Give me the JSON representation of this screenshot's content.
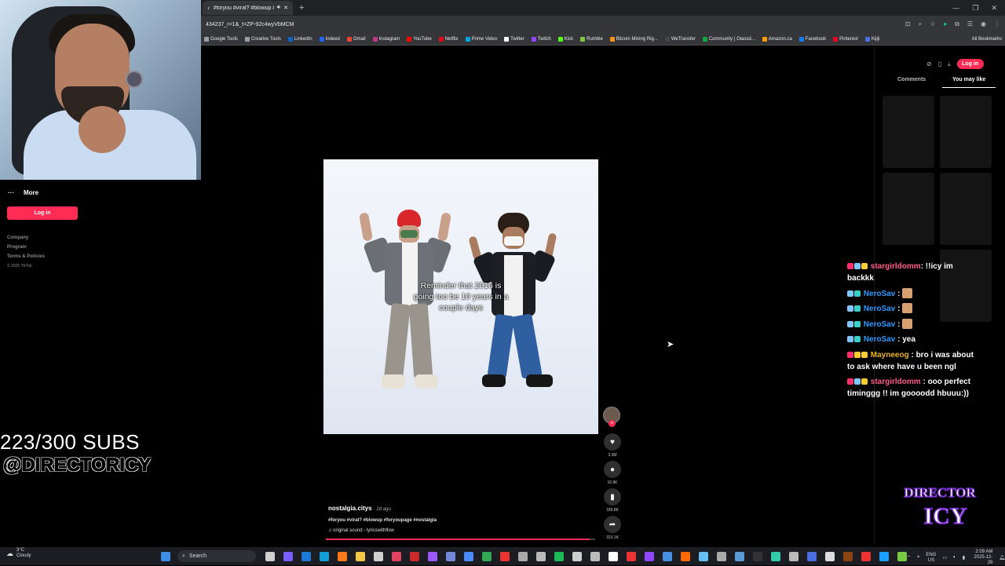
{
  "browser": {
    "tab_title": "#foryou #viral? #blowup #...",
    "url": "434237_r=1&_t=ZP-92c4wyVbMCM",
    "bookmarks": [
      "Google Tools",
      "Creative Tools",
      "LinkedIn",
      "Indeed",
      "Gmail",
      "Instagram",
      "YouTube",
      "Netflix",
      "Prime Video",
      "Twitter",
      "Twitch",
      "Kick",
      "Rumble",
      "Bitcoin Mining Rig...",
      "WeTransfer",
      "Community | Glassd...",
      "Amazon.ca",
      "Facebook",
      "Pinterest",
      "Kijiji"
    ],
    "all_bookmarks": "All Bookmarks",
    "bookmark_colors": [
      "#9aa0a6",
      "#9aa0a6",
      "#0a66c2",
      "#2164f3",
      "#ea4335",
      "#c13584",
      "#ff0000",
      "#e50914",
      "#00a8e1",
      "#ffffff",
      "#9146ff",
      "#53fc18",
      "#85c742",
      "#f7931a",
      "#444",
      "#0caa41",
      "#ff9900",
      "#1877f2",
      "#e60023",
      "#4a6ee0"
    ]
  },
  "sidebar": {
    "more_label": "More",
    "login_label": "Log in",
    "footer": [
      "Company",
      "Program",
      "Terms & Policies"
    ],
    "copyright": "© 2025 TikTok"
  },
  "video": {
    "caption_lines": [
      "Reminder that 2016 is",
      "going too be 10 years in a",
      "couple days"
    ],
    "author": "nostalgia.citys",
    "posted": "· 2d ago",
    "hashtags": "#foryou #viral? #blowup #foryoupage #nostalgia",
    "sound": "original sound - lyricswithflow",
    "likes": "3.3M",
    "comments": "16.9K",
    "saves": "185.8K",
    "shares": "323.1K",
    "progress": 0.98
  },
  "right_panel": {
    "login_label": "Log in",
    "tab_comments": "Comments",
    "tab_you_may_like": "You may like"
  },
  "chat": [
    {
      "user": "stargirldomm",
      "color": "#ff5a8a",
      "text": ": !!icy im backkk",
      "badges": [
        "#ff2d6b",
        "#7ec8ff",
        "#ffcc33"
      ],
      "emotes": 0
    },
    {
      "user": "NeroSav",
      "color": "#2b9bff",
      "text": " :",
      "badges": [
        "#7ec8ff",
        "#3ad0c8"
      ],
      "emotes": 1
    },
    {
      "user": "NeroSav",
      "color": "#2b9bff",
      "text": " :",
      "badges": [
        "#7ec8ff",
        "#3ad0c8"
      ],
      "emotes": 1
    },
    {
      "user": "NeroSav",
      "color": "#2b9bff",
      "text": " :",
      "badges": [
        "#7ec8ff",
        "#3ad0c8"
      ],
      "emotes": 1
    },
    {
      "user": "NeroSav",
      "color": "#2b9bff",
      "text": " : yea",
      "badges": [
        "#7ec8ff",
        "#3ad0c8"
      ],
      "emotes": 0
    },
    {
      "user": "Mayneeog",
      "color": "#e8b420",
      "text": " : bro i was about to ask where have u been ngl",
      "badges": [
        "#ff2d6b",
        "#ffcc33",
        "#ffcc33"
      ],
      "emotes": 0
    },
    {
      "user": "stargirldomm",
      "color": "#ff5a8a",
      "text": " : ooo perfect timinggg !! im goooodd hbuuu:))",
      "badges": [
        "#ff2d6b",
        "#7ec8ff",
        "#ffcc33"
      ],
      "emotes": 0
    }
  ],
  "overlay": {
    "subs": "223/300 SUBS",
    "handle": "@DIRECTORICY",
    "logo_top": "DIRECTOR",
    "logo_bottom": "ICY"
  },
  "taskbar": {
    "weather_temp": "3°C",
    "weather_desc": "Cloudy",
    "search_label": "Search",
    "lang": "ENG",
    "region": "US",
    "time": "2:09 AM",
    "date": "2025-12-29"
  }
}
